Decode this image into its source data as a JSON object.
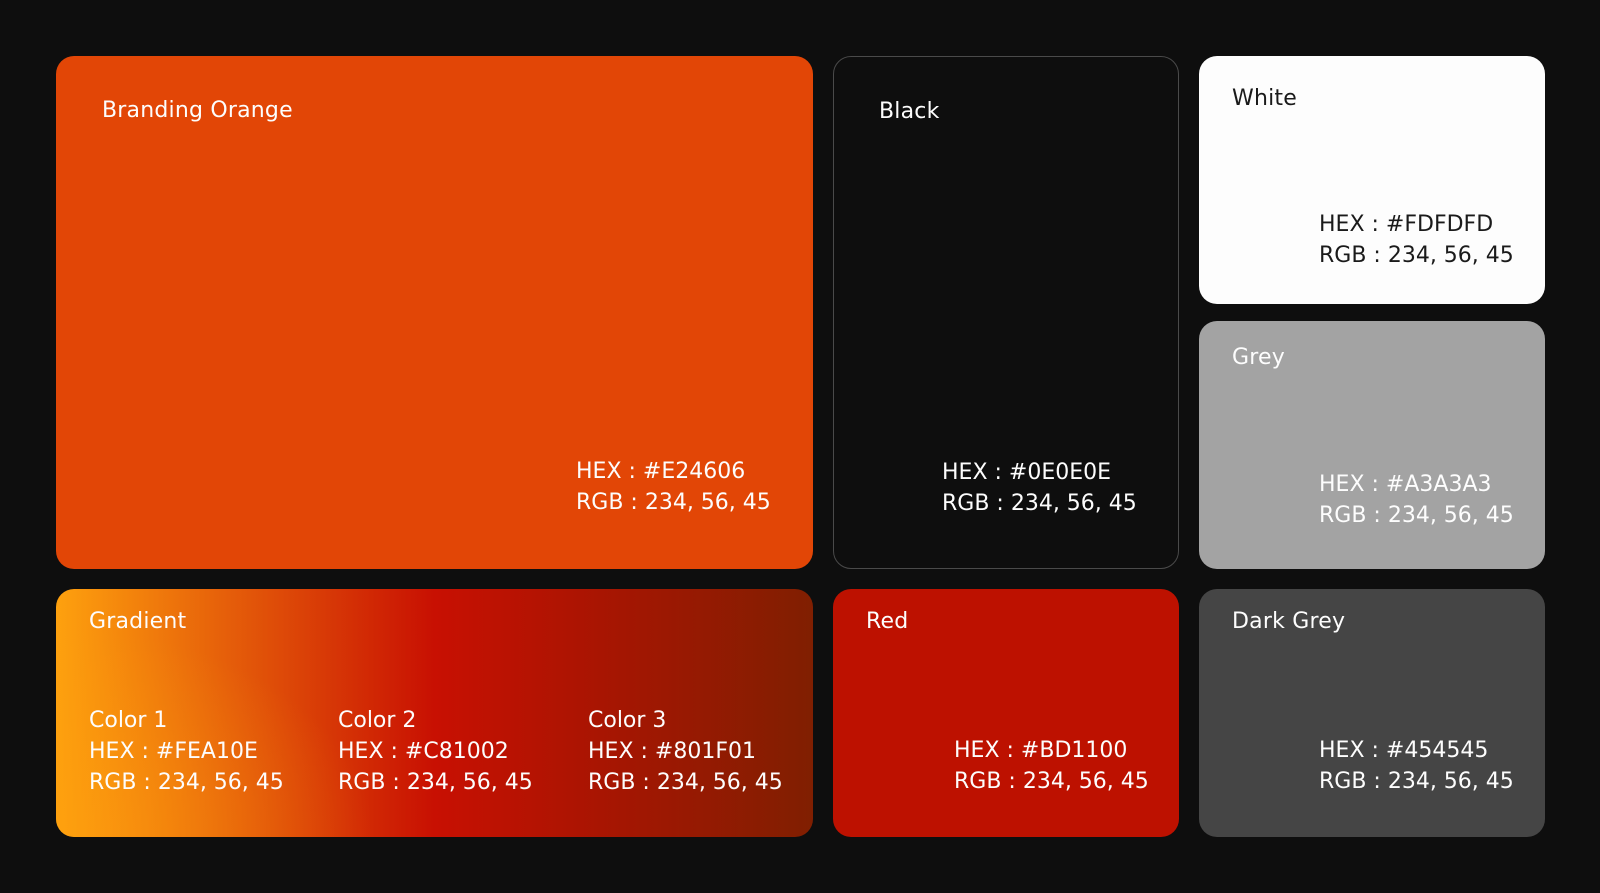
{
  "palette": {
    "branding_orange": {
      "name": "Branding Orange",
      "hex": "HEX : #E24606",
      "rgb": "RGB : 234, 56, 45",
      "color": "#E24606"
    },
    "black": {
      "name": "Black",
      "hex": "HEX : #0E0E0E",
      "rgb": "RGB : 234, 56, 45",
      "color": "#0E0E0E"
    },
    "white": {
      "name": "White",
      "hex": "HEX : #FDFDFD",
      "rgb": "RGB : 234, 56, 45",
      "color": "#FDFDFD"
    },
    "grey": {
      "name": "Grey",
      "hex": "HEX : #A3A3A3",
      "rgb": "RGB : 234, 56, 45",
      "color": "#A3A3A3"
    },
    "gradient": {
      "name": "Gradient",
      "stops": [
        {
          "label": "Color 1",
          "hex": "HEX : #FEA10E",
          "rgb": "RGB : 234, 56, 45",
          "color": "#FEA10E"
        },
        {
          "label": "Color 2",
          "hex": "HEX : #C81002",
          "rgb": "RGB : 234, 56, 45",
          "color": "#C81002"
        },
        {
          "label": "Color 3",
          "hex": "HEX : #801F01",
          "rgb": "RGB : 234, 56, 45",
          "color": "#801F01"
        }
      ]
    },
    "red": {
      "name": "Red",
      "hex": "HEX : #BD1100",
      "rgb": "RGB : 234, 56, 45",
      "color": "#BD1100"
    },
    "dark_grey": {
      "name": "Dark Grey",
      "hex": "HEX : #454545",
      "rgb": "RGB : 234, 56, 45",
      "color": "#454545"
    }
  }
}
